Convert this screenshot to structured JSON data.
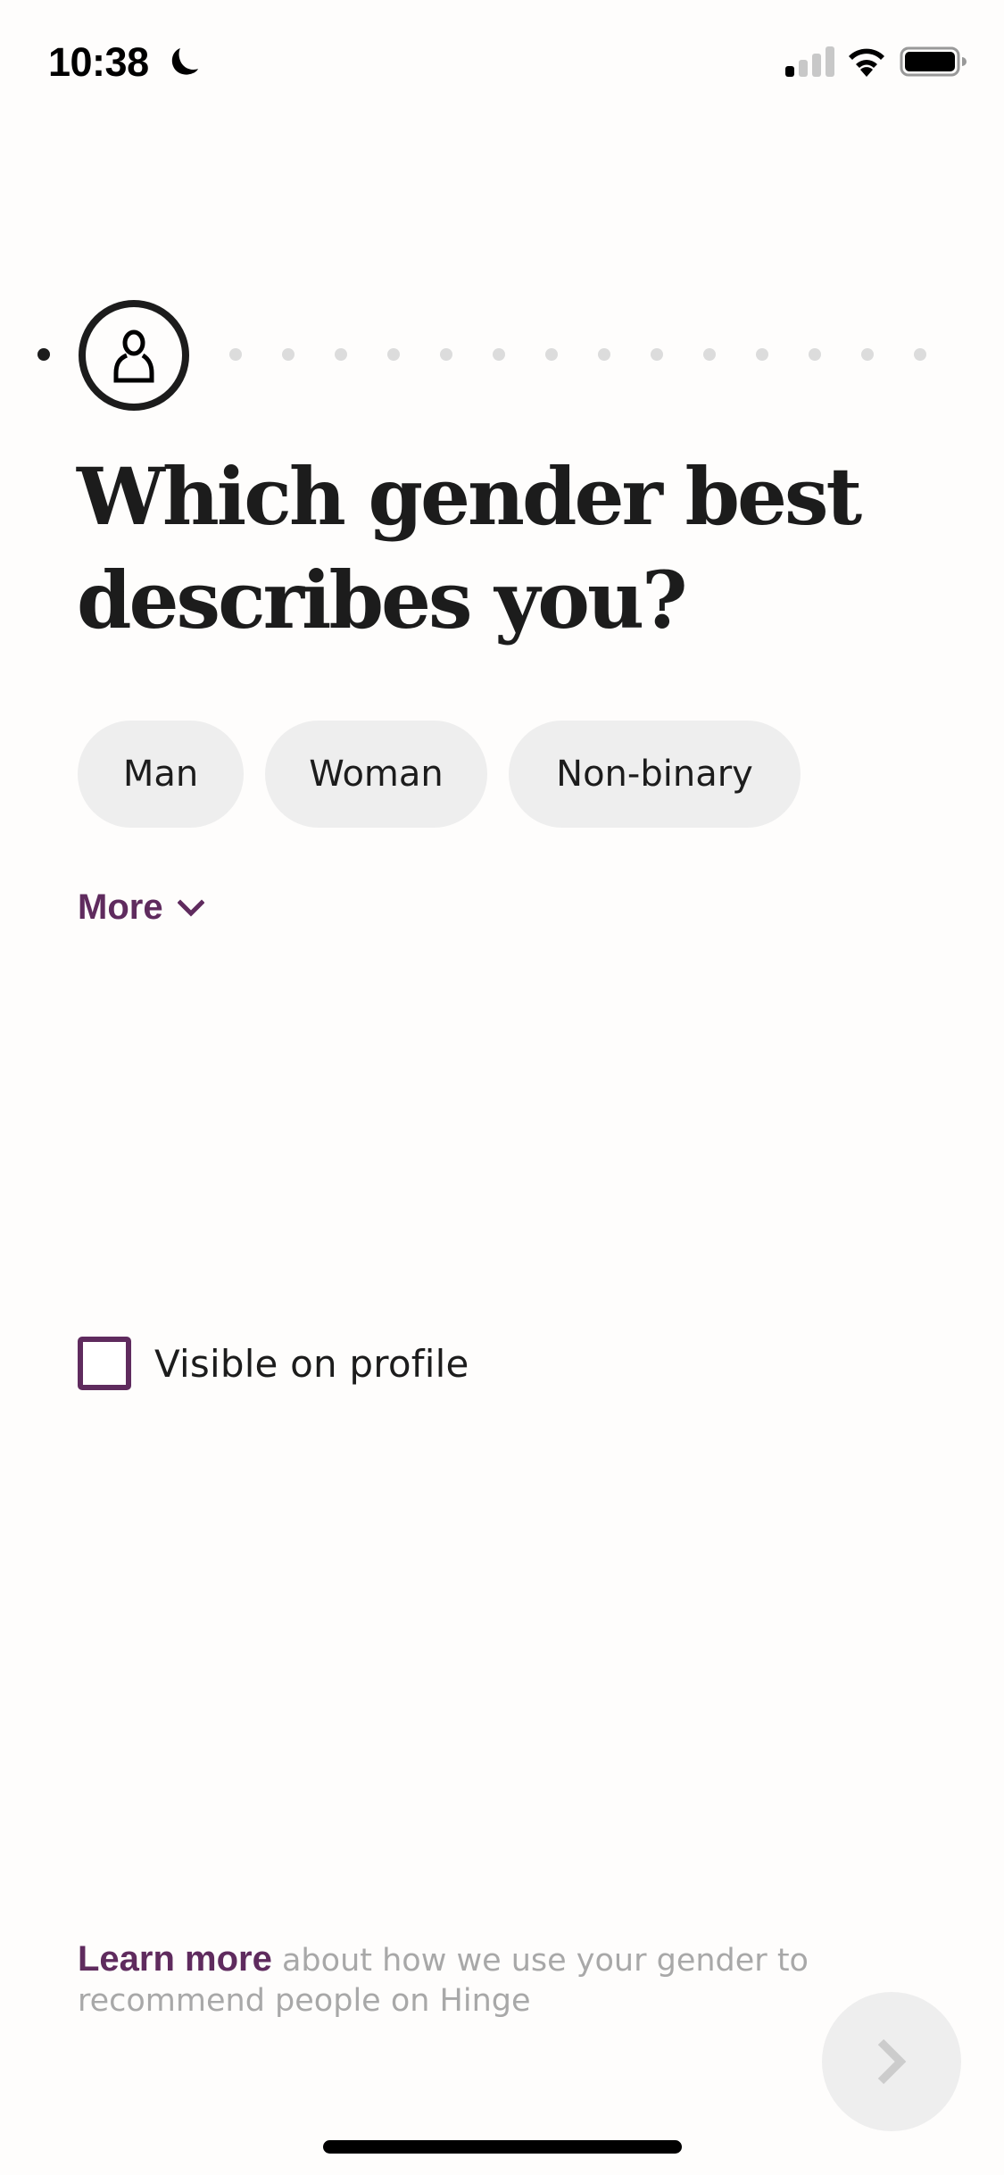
{
  "status_bar": {
    "time": "10:38",
    "focus_icon": "moon-icon",
    "signal_bars_active": 1,
    "signal_bars_total": 4,
    "wifi_icon": "wifi-icon",
    "battery_level": 1.0
  },
  "progress": {
    "completed_steps": 1,
    "current_step": 2,
    "total_steps": 16,
    "current_icon": "person-icon"
  },
  "title": {
    "line1": "Which gender best",
    "line2": "describes you?"
  },
  "options": [
    {
      "label": "Man",
      "selected": false
    },
    {
      "label": "Woman",
      "selected": false
    },
    {
      "label": "Non-binary",
      "selected": false
    }
  ],
  "more": {
    "label": "More",
    "icon": "chevron-down-icon"
  },
  "visibility": {
    "label": "Visible on profile",
    "checked": false
  },
  "footer": {
    "link_label": "Learn more",
    "text": " about how we use your gender to recommend people on Hinge"
  },
  "next_button": {
    "icon": "chevron-right-icon",
    "enabled": false
  },
  "colors": {
    "accent": "#5f2b5e",
    "text": "#1c1c1c",
    "pill_background": "#eeeeee",
    "muted_text": "#a8a8a8",
    "inactive_dot": "#dcdcdc",
    "background": "#fefdfc"
  }
}
